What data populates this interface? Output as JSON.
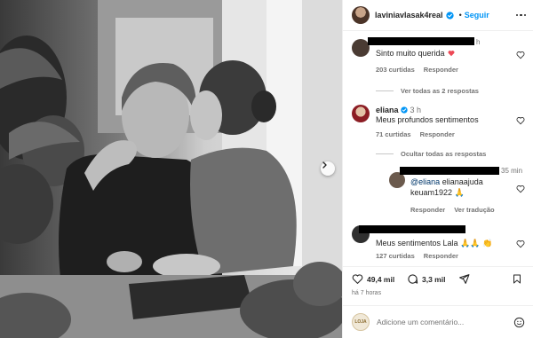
{
  "post": {
    "author": "laviniavlasak4real",
    "follow_label": "Seguir",
    "likes": "49,4 mil",
    "comments_count": "3,3 mil",
    "posted_ago": "há 7 horas"
  },
  "comments": [
    {
      "username": "",
      "time": "h",
      "text": "Sinto muito querida",
      "likes": "203 curtidas",
      "reply_label": "Responder",
      "thread_label": "Ver todas as 2 respostas"
    },
    {
      "username": "eliana",
      "time": "3 h",
      "text": "Meus profundos sentimentos",
      "likes": "71 curtidas",
      "reply_label": "Responder",
      "thread_label": "Ocultar todas as respostas"
    },
    {
      "username": "",
      "time": "35 min",
      "mention": "@eliana",
      "text_line1": "elianaajuda",
      "text_line2": "keuam1922",
      "reply_label": "Responder",
      "translate_label": "Ver tradução"
    },
    {
      "username": "",
      "time": "",
      "text": "Meus sentimentos Lala",
      "likes": "127 curtidas",
      "reply_label": "Responder"
    }
  ],
  "add_comment": {
    "placeholder": "Adicione um comentário...",
    "avatar_text": "LOJA"
  },
  "colors": {
    "accent": "#0095f6",
    "heart_red": "#ed4956",
    "muted": "#737373",
    "mention": "#00376b"
  },
  "icons": [
    "verified-badge-icon",
    "more-options-icon",
    "heart-icon",
    "comment-icon",
    "share-icon",
    "bookmark-icon",
    "emoji-icon",
    "next-photo-icon",
    "pray-emoji",
    "clap-emoji"
  ]
}
